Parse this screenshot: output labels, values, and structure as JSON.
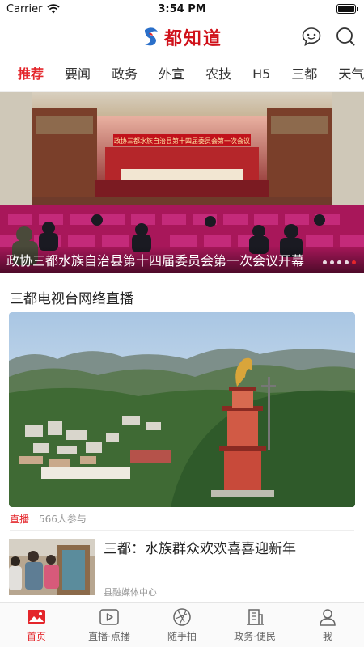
{
  "status_bar": {
    "carrier": "Carrier",
    "time": "3:54 PM",
    "battery_level": 1.0
  },
  "header": {
    "logo_text": "都知道",
    "icons": [
      "chat-bubble-icon",
      "search-icon"
    ]
  },
  "category_tabs": [
    "推荐",
    "要闻",
    "政务",
    "外宣",
    "农技",
    "H5",
    "三都",
    "天气"
  ],
  "active_tab": "推荐",
  "hero": {
    "caption": "政协三都水族自治县第十四届委员会第一次会议开幕",
    "banner_text": "政协三都水族自治县第十四届委员会第一次会议",
    "slide_count": 5,
    "active_slide": 5
  },
  "live_section": {
    "title": "三都电视台网络直播",
    "tag": "直播",
    "participants": "566人参与"
  },
  "news": [
    {
      "title": "三都：水族群众欢欢喜喜迎新年",
      "source": "县融媒体中心"
    }
  ],
  "bottom_tabs": [
    {
      "label": "首页",
      "icon": "home-image-icon",
      "active": true
    },
    {
      "label": "直播·点播",
      "icon": "play-icon",
      "active": false
    },
    {
      "label": "随手拍",
      "icon": "aperture-icon",
      "active": false
    },
    {
      "label": "政务·便民",
      "icon": "government-building-icon",
      "active": false
    },
    {
      "label": "我",
      "icon": "person-icon",
      "active": false
    }
  ],
  "colors": {
    "accent": "#e4262b",
    "brand": "#d0121b"
  }
}
